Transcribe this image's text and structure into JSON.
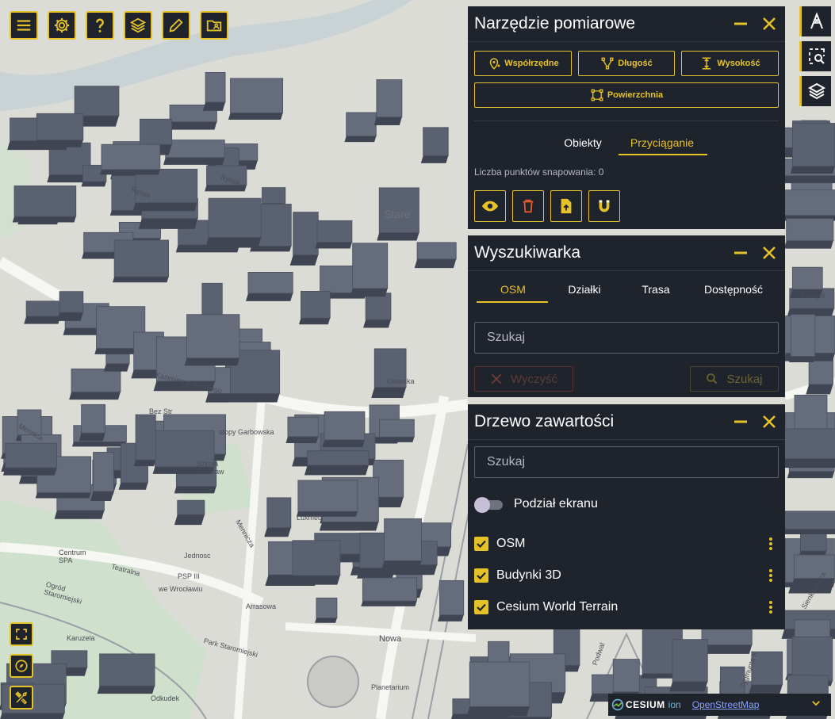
{
  "toolbar": {
    "buttons": [
      {
        "name": "menu",
        "icon": "menu-icon"
      },
      {
        "name": "settings",
        "icon": "gear-icon"
      },
      {
        "name": "help",
        "icon": "question-icon"
      },
      {
        "name": "layers",
        "icon": "layers-icon"
      },
      {
        "name": "draw",
        "icon": "pencil-icon"
      },
      {
        "name": "folder",
        "icon": "folder-icon"
      }
    ]
  },
  "left_tools": [
    {
      "name": "fullscreen",
      "icon": "fullscreen-icon"
    },
    {
      "name": "compass",
      "icon": "compass-icon"
    },
    {
      "name": "tools",
      "icon": "tools-icon"
    }
  ],
  "right_tools": [
    {
      "name": "measure",
      "icon": "measure-icon"
    },
    {
      "name": "zoom-area",
      "icon": "zoom-area-icon"
    },
    {
      "name": "layers",
      "icon": "layers-icon"
    }
  ],
  "map": {
    "labels": {
      "rynek_1": "Rynek",
      "rynek_2": "Rynek",
      "stare": "Stare",
      "kazimierza": "Kazimierza Wielkiego",
      "olawska": "Oławska",
      "bez_str": "Bez Str",
      "stopy": "stopy Garbowska",
      "szkola": "Szkoła Podstaw",
      "jednosc": "Jednosc",
      "mennicza": "Mennicza",
      "luxmed": "Luxmed",
      "arrasowa": "Arrasowa",
      "teatralna": "Teatralna",
      "psp": "PSP III",
      "we_wroclawiu": "we Wrocławiu",
      "ogrod": "Ogród Staromiejski",
      "centrum_spa": "Centrum SPA",
      "park": "Park Staromiejski",
      "nowa": "Nowa",
      "planetarium": "Planetarium",
      "karuzela": "Karuzela",
      "podwale": "Podwal",
      "purkyni": "Purkyni",
      "zygmunta": "Zygmunta K",
      "menica_left": "Mennica",
      "odkudek": "Odkudek",
      "sienkiewicza": "Sienkiewicza"
    }
  },
  "measure_panel": {
    "title": "Narzędzie pomiarowe",
    "buttons": {
      "coords": "Współrzędne",
      "length": "Długość",
      "height": "Wysokość",
      "area": "Powierzchnia"
    },
    "tabs": [
      "Obiekty",
      "Przyciąganie"
    ],
    "active_tab": "Przyciąganie",
    "snap_count_label": "Liczba punktów snapowania: 0"
  },
  "search_panel": {
    "title": "Wyszukiwarka",
    "tabs": [
      "OSM",
      "Działki",
      "Trasa",
      "Dostępność"
    ],
    "active_tab": "OSM",
    "search_placeholder": "Szukaj",
    "clear_label": "Wyczyść",
    "search_label": "Szukaj"
  },
  "tree_panel": {
    "title": "Drzewo zawartości",
    "search_placeholder": "Szukaj",
    "split_label": "Podział ekranu",
    "split_on": false,
    "layers": [
      {
        "label": "OSM",
        "checked": true
      },
      {
        "label": "Budynki 3D",
        "checked": true
      },
      {
        "label": "Cesium World Terrain",
        "checked": true
      }
    ]
  },
  "attribution": {
    "cesium": "CESIUM",
    "ion": "ion",
    "osm": "OpenStreetMap"
  },
  "colors": {
    "accent": "#e6c229",
    "panel_bg": "#1f232b",
    "building": "#5a6170",
    "danger": "#d04040"
  }
}
